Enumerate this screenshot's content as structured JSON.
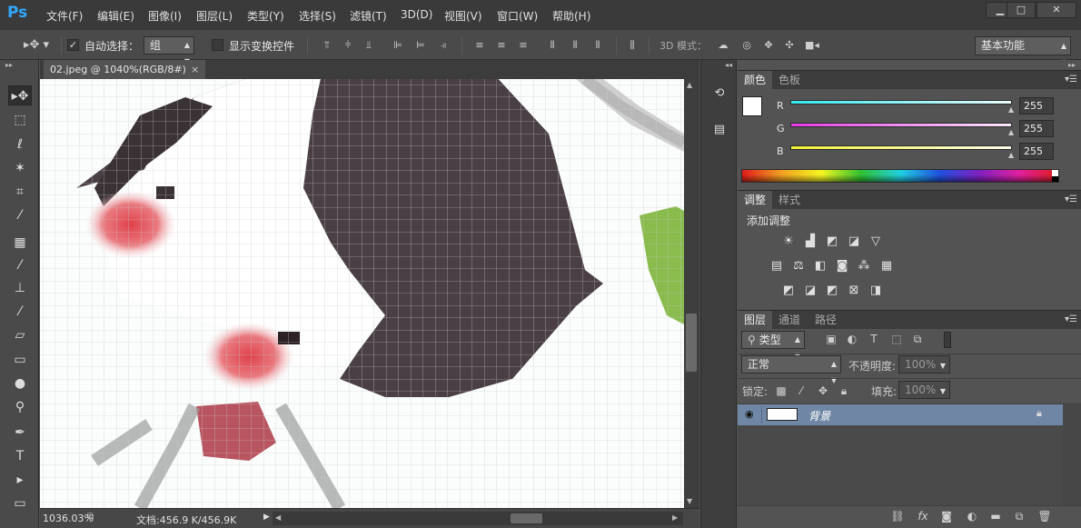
{
  "app": {
    "logo": "Ps"
  },
  "menu": [
    "文件(F)",
    "编辑(E)",
    "图像(I)",
    "图层(L)",
    "类型(Y)",
    "选择(S)",
    "滤镜(T)",
    "3D(D)",
    "视图(V)",
    "窗口(W)",
    "帮助(H)"
  ],
  "window_controls": {
    "minimize": "▁",
    "maximize": "□",
    "close": "✕"
  },
  "options": {
    "auto_select_label": "自动选择：",
    "auto_select_value": "组",
    "transform_label": "显示变换控件",
    "mode3d_label": "3D 模式：",
    "workspace": "基本功能"
  },
  "document": {
    "tab_title": "02.jpeg @ 1040%(RGB/8#)",
    "tab_close": "×",
    "zoom": "1036.03%",
    "doc_info": "文档:456.9 K/456.9K"
  },
  "color_panel": {
    "tabs": [
      "颜色",
      "色板"
    ],
    "channels": [
      {
        "label": "R",
        "value": "255",
        "color": "#35e8f0"
      },
      {
        "label": "G",
        "value": "255",
        "color": "#e83ae8"
      },
      {
        "label": "B",
        "value": "255",
        "color": "#f0f03a"
      }
    ]
  },
  "adjust_panel": {
    "tabs": [
      "调整",
      "样式"
    ],
    "title": "添加调整",
    "row1_icons": [
      "brightness-icon",
      "levels-icon",
      "curves-icon",
      "exposure-icon",
      "vibrance-icon"
    ],
    "row2_icons": [
      "hue-saturation-icon",
      "color-balance-icon",
      "black-white-icon",
      "photo-filter-icon",
      "channel-mixer-icon",
      "color-lookup-icon"
    ],
    "row3_icons": [
      "invert-icon",
      "posterize-icon",
      "threshold-icon",
      "selective-color-icon",
      "gradient-map-icon"
    ]
  },
  "layers_panel": {
    "tabs": [
      "图层",
      "通道",
      "路径"
    ],
    "filter_label": "类型",
    "blend_mode": "正常",
    "opacity_label": "不透明度:",
    "opacity_value": "100%",
    "lock_label": "锁定:",
    "fill_label": "填充:",
    "fill_value": "100%",
    "layers": [
      {
        "name": "背景",
        "visible": true,
        "locked": true
      }
    ]
  },
  "colors": {
    "menubar": "#3a3a3a",
    "panel": "#535353",
    "selected_layer": "#6f87a4",
    "ps_blue": "#31a8ff"
  }
}
